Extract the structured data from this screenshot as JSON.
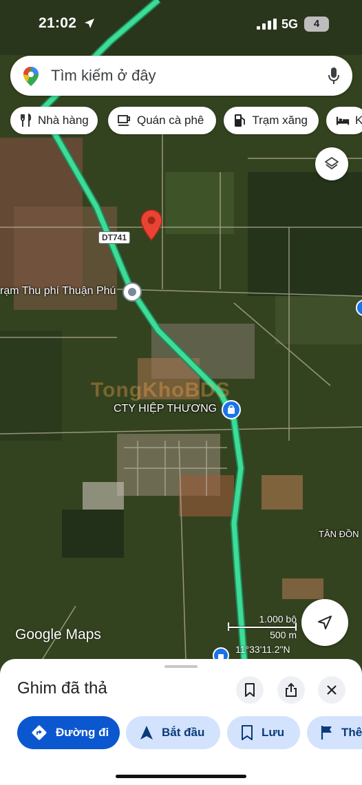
{
  "status_bar": {
    "time": "21:02",
    "network": "5G",
    "battery": "4"
  },
  "search": {
    "placeholder": "Tìm kiếm ở đây"
  },
  "chips": [
    {
      "label": "Nhà hàng",
      "icon": "fork-knife-icon"
    },
    {
      "label": "Quán cà phê",
      "icon": "coffee-cup-icon"
    },
    {
      "label": "Trạm xăng",
      "icon": "gas-pump-icon"
    },
    {
      "label": "K",
      "icon": "bed-icon"
    }
  ],
  "map": {
    "road_shield": "DT741",
    "labels": {
      "toll_station": "rạm Thu phí Thuận Phú",
      "company": "CTY HIỆP THƯƠNG",
      "area": "TÂN ĐỒN",
      "watermark": "TongKhoBDS"
    },
    "colors": {
      "route": "#3ddc97",
      "pin": "#ea4335"
    },
    "logo": "Google Maps",
    "scale": {
      "imperial": "1.000 bộ",
      "metric": "500 m"
    },
    "coordinates": "11°33'11.2\"N"
  },
  "sheet": {
    "title": "Ghim đã thả",
    "actions": [
      {
        "label": "Đường đi",
        "icon": "directions-icon"
      },
      {
        "label": "Bắt đầu",
        "icon": "navigation-arrow-icon"
      },
      {
        "label": "Lưu",
        "icon": "bookmark-icon"
      },
      {
        "label": "Thê",
        "icon": "flag-icon"
      }
    ]
  }
}
